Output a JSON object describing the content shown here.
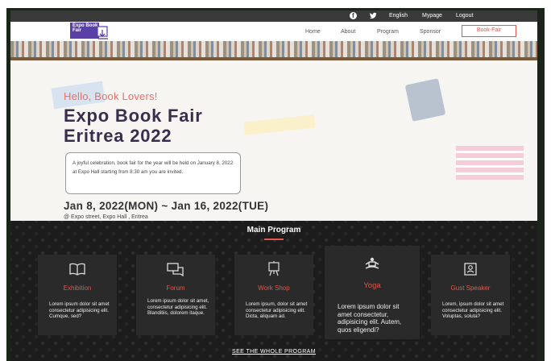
{
  "topbar": {
    "facebook_icon": "facebook-icon",
    "twitter_icon": "twitter-icon",
    "english": "English",
    "mypage": "Mypage",
    "logout": "Logout"
  },
  "logo": {
    "text": "Expo Book Fair"
  },
  "nav": {
    "home": "Home",
    "about": "About",
    "program": "Program",
    "sponsor": "Sponsor",
    "bookfair": "Book-Fair"
  },
  "hero": {
    "greeting": "Hello, Book Lovers!",
    "title_line1": "Expo Book Fair",
    "title_line2": "Eritrea 2022",
    "description": "A joyful celebration, book fair for the year will be held on January 8, 2022 at Expo Hall starting from 8:30 am you are invited.",
    "dates": "Jan 8, 2022(MON) ~ Jan 16, 2022(TUE)",
    "address": "@ Expo street, Expo Hall , Eritrea"
  },
  "program": {
    "title": "Main Program",
    "cards": [
      {
        "icon": "open-book-icon",
        "title": "Exhibition",
        "text": "Lorem ipsum dolor sit amet consectetur adipisicing elit. Cumque, sed?"
      },
      {
        "icon": "chat-icon",
        "title": "Forum",
        "text": "Lorem ipsum dolor sit amet, consectetur adipisicing elit. Blanditiis, dolorem itaque."
      },
      {
        "icon": "easel-icon",
        "title": "Work Shop",
        "text": "Lorem ipsum, dolor sit amet consectetur adipisicing elit. Dicta, aliquam ad."
      },
      {
        "icon": "yoga-icon",
        "title": "Yoga",
        "text": "Lorem ipsum dolor sit amet consectetur, adipisicing elit. Autem, quos eligendi?"
      },
      {
        "icon": "portrait-icon",
        "title": "Gust Speaker",
        "text": "Lorem, ipsum dolor sit amet consectetur adipisicing elit. Voluptas, soluta?"
      }
    ],
    "see_all": "SEE THE WHOLE PROGRAM"
  },
  "colors": {
    "accent": "#e0584f",
    "dark": "#1c1c1c",
    "title": "#3a2e4e"
  }
}
